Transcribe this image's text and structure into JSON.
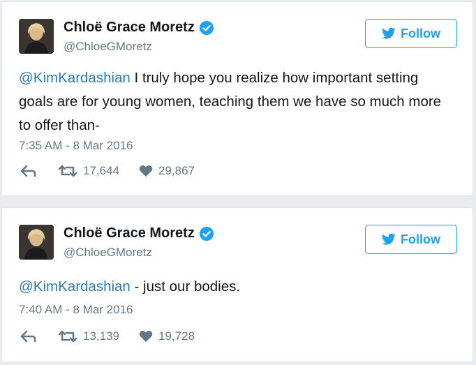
{
  "tweets": [
    {
      "name": "Chloë Grace Moretz",
      "handle": "@ChloeGMoretz",
      "follow_label": "Follow",
      "mention": "@KimKardashian",
      "text": " I truly hope you realize how important setting goals are for young women, teaching them we have so much more to offer than-",
      "timestamp": "7:35 AM - 8 Mar 2016",
      "retweets": "17,644",
      "likes": "29,867"
    },
    {
      "name": "Chloë Grace Moretz",
      "handle": "@ChloeGMoretz",
      "follow_label": "Follow",
      "mention": "@KimKardashian",
      "text": " - just our bodies.",
      "timestamp": "7:40 AM - 8 Mar 2016",
      "retweets": "13,139",
      "likes": "19,728"
    }
  ],
  "icons": {
    "verified": "verified-badge-icon",
    "follow": "twitter-bird-icon",
    "reply": "reply-arrow-icon",
    "retweet": "retweet-icon",
    "like": "heart-icon"
  },
  "colors": {
    "accent": "#1da1f2",
    "mention": "#2b7bb9",
    "muted": "#657786",
    "text": "#14171a"
  }
}
